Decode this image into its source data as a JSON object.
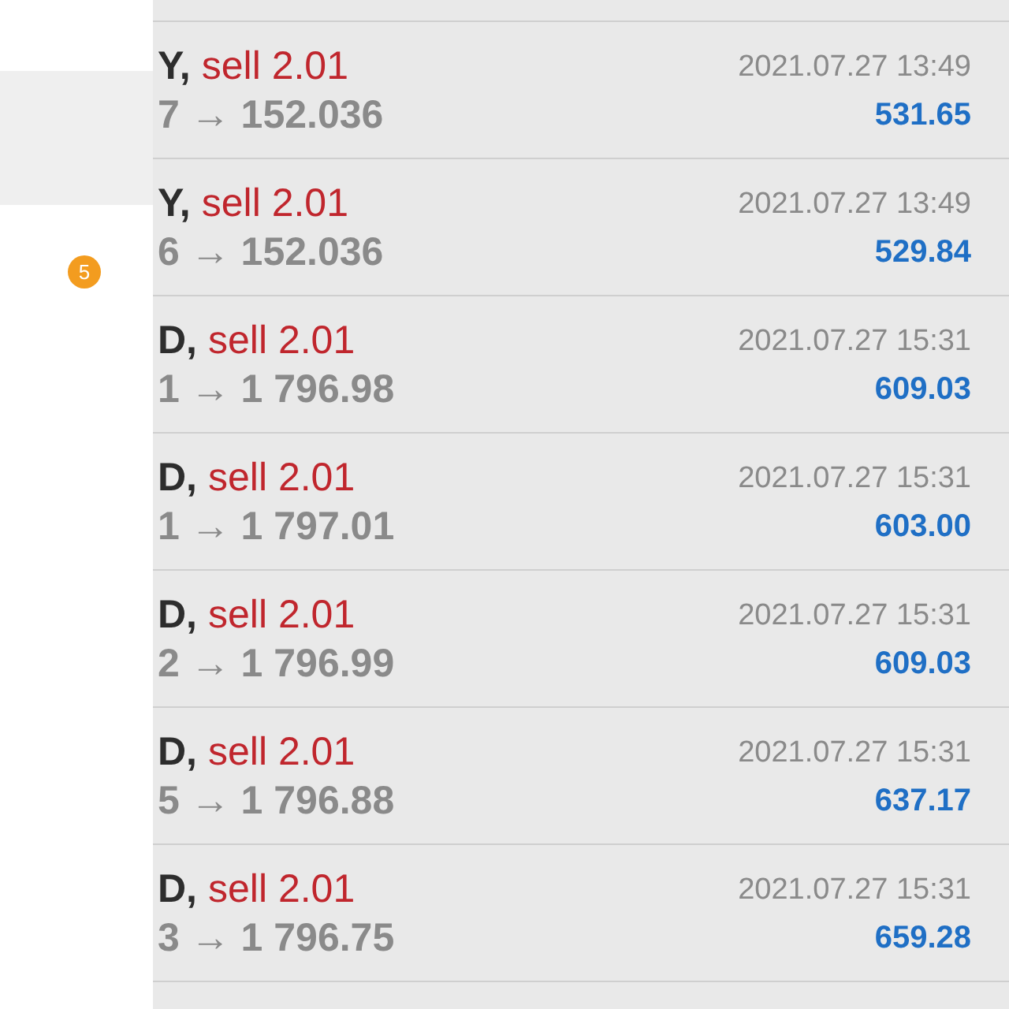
{
  "drawer": {
    "items": [
      {
        "selected": true
      },
      {
        "selected": false,
        "badge": "5"
      }
    ]
  },
  "trades": [
    {
      "symbol": "Y,",
      "order": "sell 2.01",
      "prices": "7 → 152.036",
      "time": "2021.07.27 13:49",
      "profit": "531.65"
    },
    {
      "symbol": "Y,",
      "order": "sell 2.01",
      "prices": "6 → 152.036",
      "time": "2021.07.27 13:49",
      "profit": "529.84"
    },
    {
      "symbol": "D,",
      "order": "sell 2.01",
      "prices": "1 → 1 796.98",
      "time": "2021.07.27 15:31",
      "profit": "609.03"
    },
    {
      "symbol": "D,",
      "order": "sell 2.01",
      "prices": "1 → 1 797.01",
      "time": "2021.07.27 15:31",
      "profit": "603.00"
    },
    {
      "symbol": "D,",
      "order": "sell 2.01",
      "prices": "2 → 1 796.99",
      "time": "2021.07.27 15:31",
      "profit": "609.03"
    },
    {
      "symbol": "D,",
      "order": "sell 2.01",
      "prices": "5 → 1 796.88",
      "time": "2021.07.27 15:31",
      "profit": "637.17"
    },
    {
      "symbol": "D,",
      "order": "sell 2.01",
      "prices": "3 → 1 796.75",
      "time": "2021.07.27 15:31",
      "profit": "659.28"
    }
  ]
}
